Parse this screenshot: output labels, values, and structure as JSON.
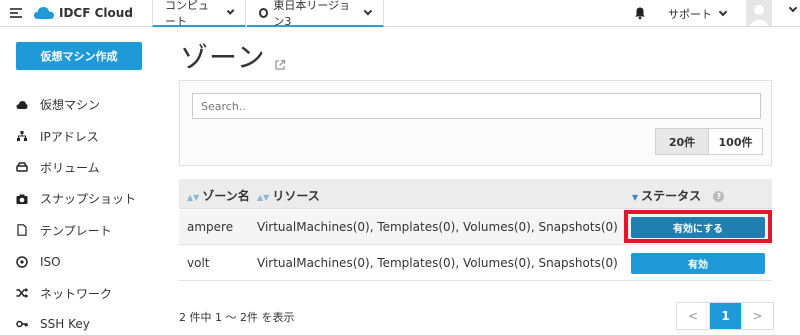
{
  "header": {
    "logo_text": "IDCF Cloud",
    "nav_compute": "コンピュート",
    "nav_region": "東日本リージョン3",
    "nav_support": "サポート"
  },
  "sidebar": {
    "create_label": "仮想マシン作成",
    "items": [
      {
        "label": "仮想マシン",
        "icon": "cloud-icon"
      },
      {
        "label": "IPアドレス",
        "icon": "network-icon"
      },
      {
        "label": "ボリューム",
        "icon": "drive-icon"
      },
      {
        "label": "スナップショット",
        "icon": "camera-icon"
      },
      {
        "label": "テンプレート",
        "icon": "file-icon"
      },
      {
        "label": "ISO",
        "icon": "disc-icon"
      },
      {
        "label": "ネットワーク",
        "icon": "shuffle-icon"
      },
      {
        "label": "SSH Key",
        "icon": "key-icon"
      }
    ]
  },
  "main": {
    "title": "ゾーン",
    "search_placeholder": "Search..",
    "page_size_options": [
      "20件",
      "100件"
    ],
    "page_size_selected": "20件",
    "table": {
      "headers": [
        "ゾーン名",
        "リソース",
        "ステータス"
      ],
      "rows": [
        {
          "zone": "ampere",
          "resources": "VirtualMachines(0), Templates(0), Volumes(0), Snapshots(0), I...",
          "status": "有効にする"
        },
        {
          "zone": "volt",
          "resources": "VirtualMachines(0), Templates(0), Volumes(0), Snapshots(0), I...",
          "status": "有効"
        }
      ]
    },
    "count_text": "2 件中 1 ～ 2件 を表示",
    "pagination": {
      "prev": "<",
      "current": "1",
      "next": ">"
    }
  },
  "colors": {
    "accent": "#1f9ad6",
    "highlight": "#e0162b"
  }
}
